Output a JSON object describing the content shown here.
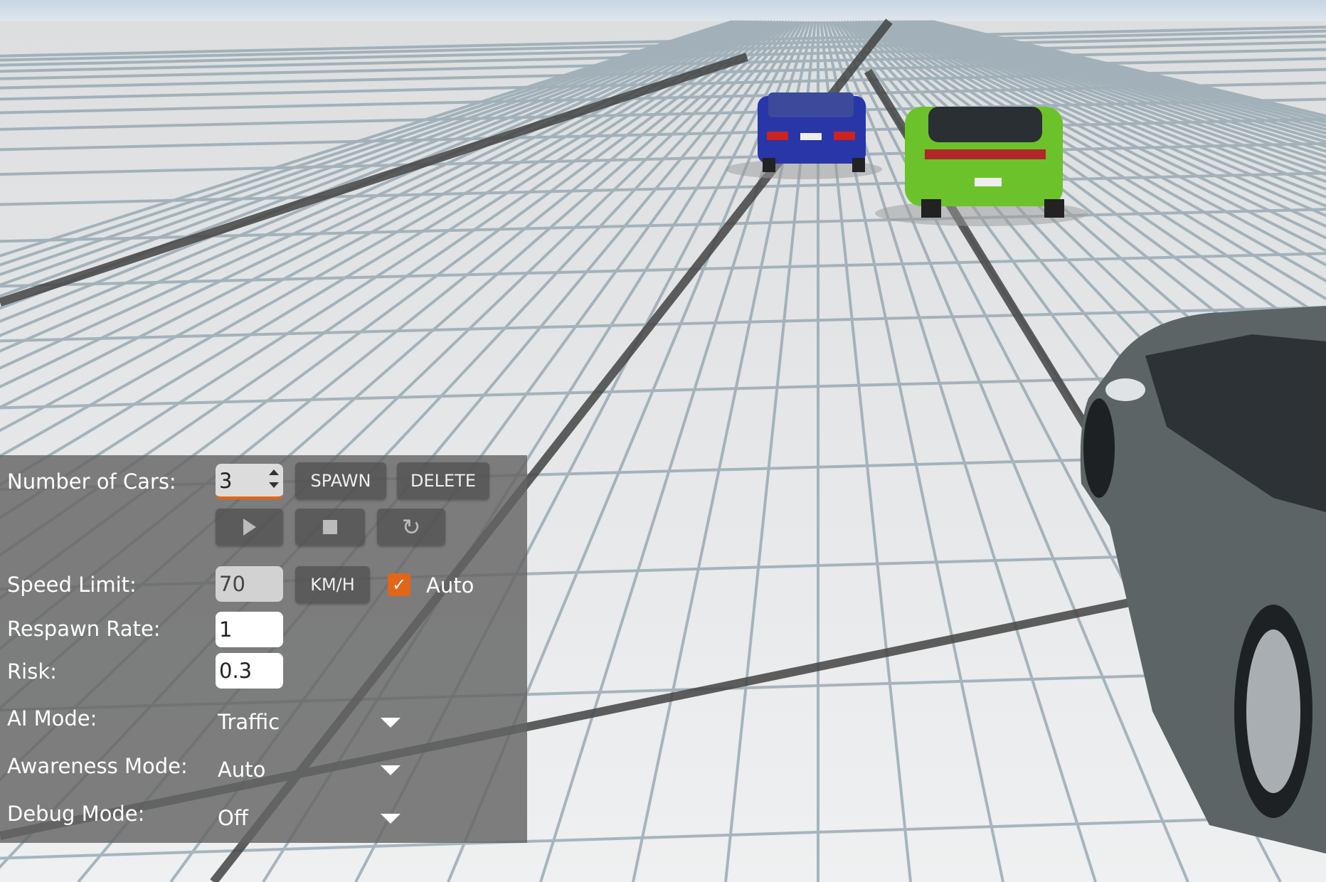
{
  "panel": {
    "num_cars": {
      "label": "Number of Cars:",
      "value": "3",
      "spawn_label": "SPAWN",
      "delete_label": "DELETE"
    },
    "controls": {
      "play_icon": "play-icon",
      "stop_icon": "stop-icon",
      "reset_icon": "refresh-icon"
    },
    "speed_limit": {
      "label": "Speed Limit:",
      "value": "70",
      "unit_label": "KM/H",
      "auto_checked": true,
      "auto_label": "Auto"
    },
    "respawn_rate": {
      "label": "Respawn Rate:",
      "value": "1"
    },
    "risk": {
      "label": "Risk:",
      "value": "0.3"
    },
    "ai_mode": {
      "label": "AI Mode:",
      "value": "Traffic"
    },
    "awareness_mode": {
      "label": "Awareness Mode:",
      "value": "Auto"
    },
    "debug_mode": {
      "label": "Debug Mode:",
      "value": "Off"
    }
  },
  "colors": {
    "accent": "#e0661a",
    "panel_bg": "#646464",
    "car_blue": "#2836a8",
    "car_green": "#6cc22a",
    "car_grey": "#5c6466"
  }
}
